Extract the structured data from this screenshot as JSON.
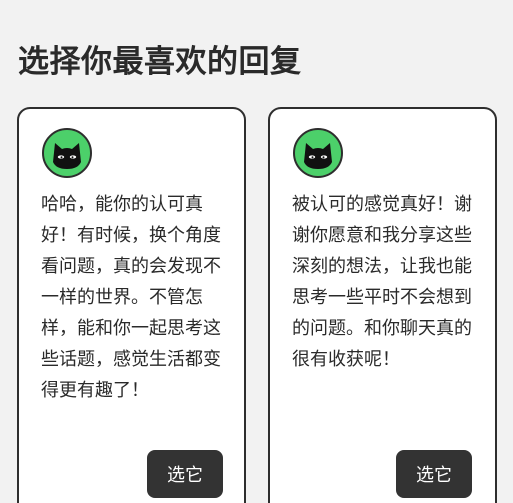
{
  "page": {
    "title": "选择你最喜欢的回复"
  },
  "colors": {
    "background": "#f2f2f2",
    "card_border": "#2e2e2e",
    "button": "#333333",
    "avatar_green": "#4cd06a"
  },
  "options": [
    {
      "avatar_icon": "black-cat-avatar-icon",
      "text": "哈哈，能你的认可真好！有时候，换个角度看问题，真的会发现不一样的世界。不管怎样，能和你一起思考这些话题，感觉生活都变得更有趣了！",
      "button_label": "选它"
    },
    {
      "avatar_icon": "black-cat-avatar-icon",
      "text": "被认可的感觉真好！谢谢你愿意和我分享这些深刻的想法，让我也能思考一些平时不会想到的问题。和你聊天真的很有收获呢！",
      "button_label": "选它"
    }
  ]
}
